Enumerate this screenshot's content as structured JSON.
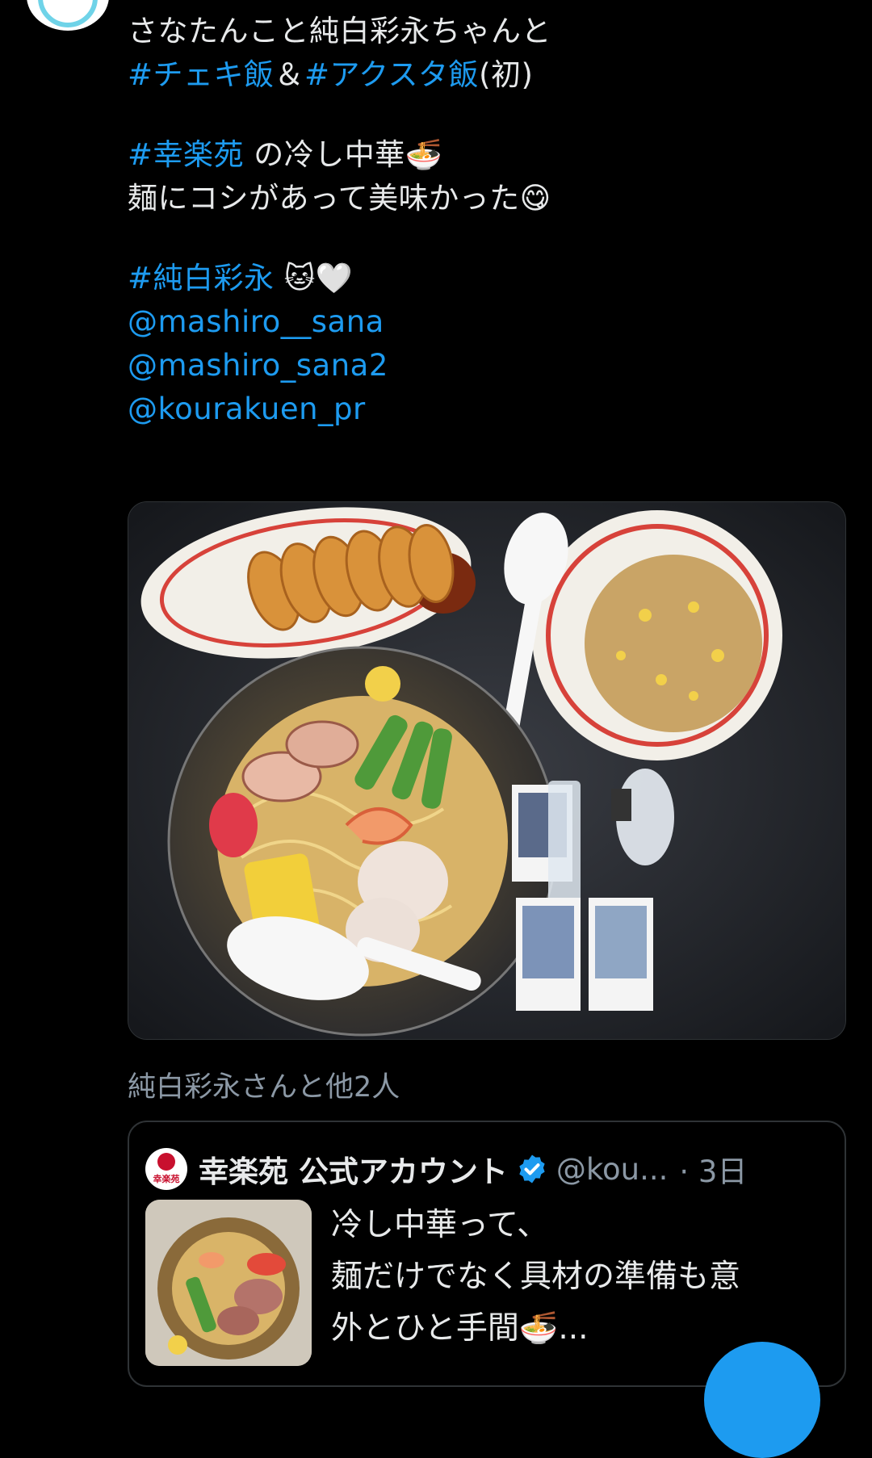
{
  "tweet": {
    "lines": [
      {
        "parts": [
          {
            "t": "さなたんこと純白彩永ちゃんと",
            "link": false
          }
        ]
      },
      {
        "parts": [
          {
            "t": "#チェキ飯",
            "link": true
          },
          {
            "t": "＆",
            "link": false
          },
          {
            "t": "#アクスタ飯",
            "link": true
          },
          {
            "t": "(初)",
            "link": false
          }
        ]
      },
      {
        "gap": true
      },
      {
        "parts": [
          {
            "t": "#幸楽苑",
            "link": true
          },
          {
            "t": " の冷し中華🍜",
            "link": false
          }
        ]
      },
      {
        "parts": [
          {
            "t": "麺にコシがあって美味かった😋",
            "link": false
          }
        ]
      },
      {
        "gap": true
      },
      {
        "parts": [
          {
            "t": "#純白彩永",
            "link": true
          },
          {
            "t": " 🐱🤍",
            "link": false
          }
        ]
      },
      {
        "parts": [
          {
            "t": "@mashiro__sana",
            "link": true
          }
        ]
      },
      {
        "parts": [
          {
            "t": "@mashiro_sana2",
            "link": true
          }
        ]
      },
      {
        "parts": [
          {
            "t": "@kourakuen_pr",
            "link": true
          }
        ]
      }
    ]
  },
  "tagged_users": "純白彩永さんと他2人",
  "quote": {
    "name": "幸楽苑 公式アカウント",
    "handle": "@kou...",
    "time": "· 3日",
    "avatar_text": "幸楽苑",
    "text_lines": [
      "冷し中華って、",
      "麺だけでなく具材の準備も意",
      "外とひと手間🍜..."
    ]
  },
  "colors": {
    "link": "#1d9bf0",
    "background": "#000000",
    "muted": "#8b98a5"
  },
  "icons": {
    "verified": "verified-badge-icon",
    "compose": "compose-fab-icon"
  }
}
